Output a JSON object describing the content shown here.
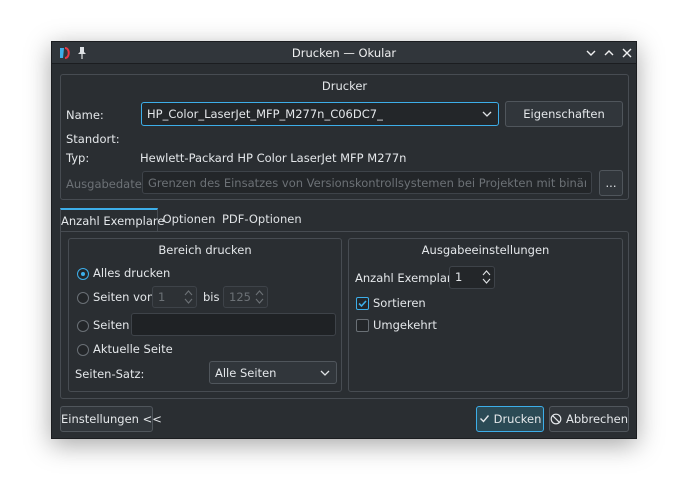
{
  "window": {
    "title": "Drucken — Okular"
  },
  "printer_group": {
    "title": "Drucker",
    "name_label": "Name:",
    "printer_value": "HP_Color_LaserJet_MFP_M277n_C06DC7_",
    "properties_button": "Eigenschaften",
    "location_label": "Standort:",
    "location_value": "",
    "type_label": "Typ:",
    "type_value": "Hewlett-Packard HP Color LaserJet MFP M277n",
    "output_file_label": "Ausgabedatei:",
    "output_file_placeholder": "Grenzen des Einsatzes von Versionskontrollsystemen bei Projekten mit binären Dateien.pdf",
    "browse_button": "..."
  },
  "tabs": [
    {
      "label": "Anzahl Exemplare",
      "active": true
    },
    {
      "label": "Optionen",
      "active": false
    },
    {
      "label": "PDF-Optionen",
      "active": false
    }
  ],
  "print_range": {
    "title": "Bereich drucken",
    "all_pages": "Alles drucken",
    "pages_from": "Seiten von",
    "from_value": "1",
    "to_label": "bis",
    "to_value": "125",
    "pages": "Seiten",
    "pages_value": "",
    "current_page": "Aktuelle Seite",
    "page_set_label": "Seiten-Satz:",
    "page_set_value": "Alle Seiten",
    "selected": "all"
  },
  "output_settings": {
    "title": "Ausgabeeinstellungen",
    "copies_label": "Anzahl Exemplare:",
    "copies_value": "1",
    "collate_label": "Sortieren",
    "collate_checked": true,
    "reverse_label": "Umgekehrt",
    "reverse_checked": false
  },
  "footer": {
    "settings_button": "Einstellungen <<",
    "print_button": "Drucken",
    "cancel_button": "Abbrechen"
  },
  "colors": {
    "accent": "#3daee9",
    "background": "#2a2e32"
  }
}
